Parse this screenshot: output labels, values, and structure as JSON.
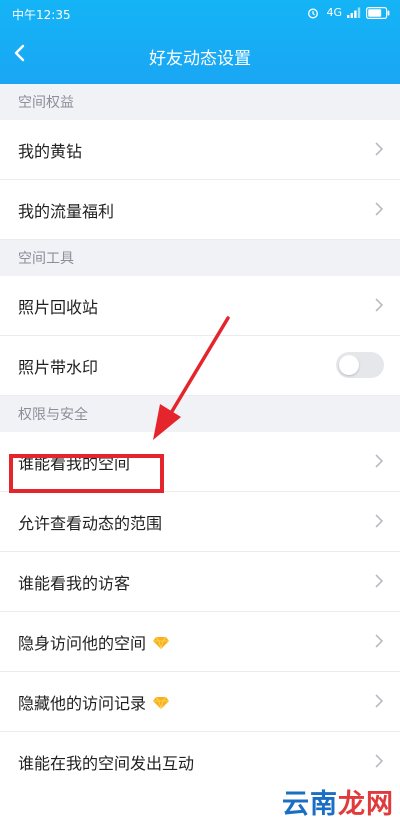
{
  "status": {
    "time": "中午12:35",
    "network": "4G"
  },
  "header": {
    "title": "好友动态设置"
  },
  "sections": [
    {
      "title": "空间权益",
      "items": [
        {
          "label": "我的黄钻"
        },
        {
          "label": "我的流量福利"
        }
      ]
    },
    {
      "title": "空间工具",
      "items": [
        {
          "label": "照片回收站"
        },
        {
          "label": "照片带水印",
          "toggle": false
        }
      ]
    },
    {
      "title": "权限与安全",
      "items": [
        {
          "label": "谁能看我的空间"
        },
        {
          "label": "允许查看动态的范围"
        },
        {
          "label": "谁能看我的访客"
        },
        {
          "label": "隐身访问他的空间",
          "badge": "diamond-icon"
        },
        {
          "label": "隐藏他的访问记录",
          "badge": "diamond-icon"
        },
        {
          "label": "谁能在我的空间发出互动"
        }
      ]
    }
  ],
  "watermark": {
    "part1": "云南",
    "part2": "龙网"
  },
  "colors": {
    "header": "#1aa6f4",
    "highlight": "#e4252c",
    "section_bg": "#f1f2f6"
  }
}
